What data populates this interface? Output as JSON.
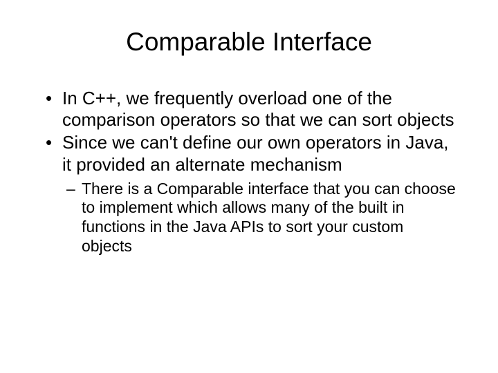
{
  "slide": {
    "title": "Comparable Interface",
    "bullets": [
      {
        "text": "In C++, we frequently overload one of the comparison operators so that we can sort objects"
      },
      {
        "text": "Since we can't define our own operators in Java, it provided an alternate mechanism"
      }
    ],
    "subBullets": [
      {
        "text": "There is a Comparable interface that you can choose to implement which allows many of the built in functions in the Java APIs to sort your custom objects"
      }
    ]
  }
}
